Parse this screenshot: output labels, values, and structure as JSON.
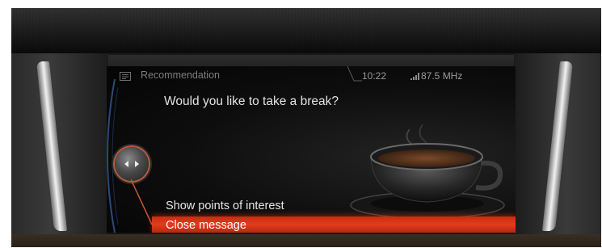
{
  "header": {
    "title": "Recommendation",
    "clock": "10:22",
    "radio_frequency": "87.5 MHz"
  },
  "message": {
    "question": "Would you like to take a break?"
  },
  "menu": {
    "items": [
      {
        "label": "Show points of interest",
        "selected": false
      },
      {
        "label": "Close message",
        "selected": true
      }
    ]
  },
  "icons": {
    "title_icon": "message-icon",
    "signal_icon": "signal-icon",
    "option_icon": "plus-icon",
    "controller_icon": "controller-icon",
    "illustration": "coffee-cup-icon"
  },
  "colors": {
    "highlight": "#e23d1c",
    "text": "#e6e6e6",
    "muted_text": "#7d7d7d"
  }
}
